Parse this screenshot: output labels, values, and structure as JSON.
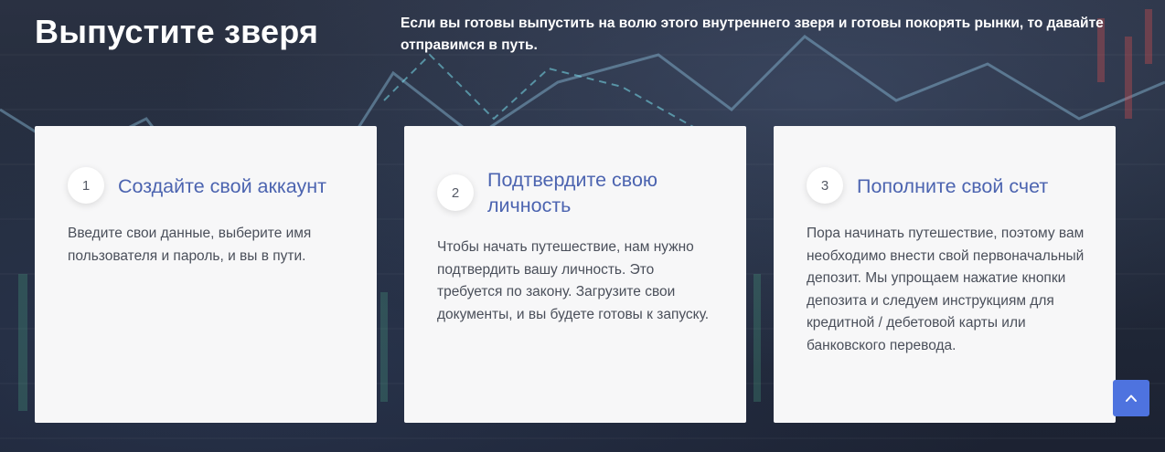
{
  "headline": "Выпустите зверя",
  "intro": "Если вы готовы выпустить на волю этого внутреннего зверя и готовы покорять рынки, то давайте отправимся в путь.",
  "steps": [
    {
      "number": "1",
      "title": "Создайте свой аккаунт",
      "text": "Введите свои данные, выберите имя пользователя и пароль, и вы в пути."
    },
    {
      "number": "2",
      "title": "Подтвердите свою личность",
      "text": "Чтобы начать путешествие, нам нужно подтвердить вашу личность. Это требуется по закону. Загрузите свои документы, и вы будете готовы к запуску."
    },
    {
      "number": "3",
      "title": "Пополните свой счет",
      "text": "Пора начинать путешествие, поэтому вам необходимо внести свой первоначальный депозит. Мы упрощаем нажатие кнопки депозита и следуем инструкциям для кредитной / дебетовой карты или банковского перевода."
    }
  ],
  "scroll_top_icon": "chevron-up-icon",
  "colors": {
    "accent": "#4e73df",
    "title": "#4c64b0",
    "card_bg": "#f7f7f8",
    "page_bg": "#222a3a"
  }
}
